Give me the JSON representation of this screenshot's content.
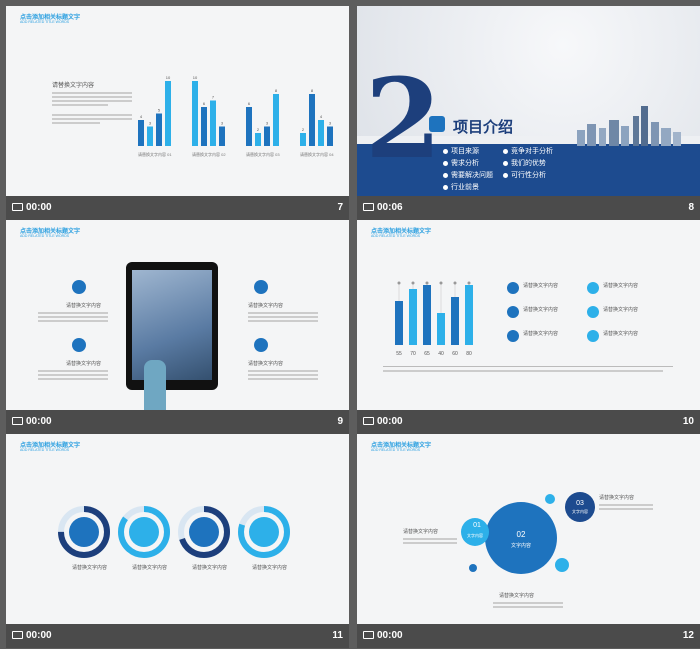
{
  "colors": {
    "blue": "#1e73be",
    "light": "#2db0e9",
    "dark": "#1d3f7c",
    "bg": "#5d5d5d"
  },
  "header": {
    "title": "点击添加相关标题文字",
    "sub": "ADD RELATED TITLE WORDS"
  },
  "slides": [
    {
      "num": "7",
      "time": "00:00",
      "body_title": "请替换文字内容",
      "group_labels": [
        "请替换文字内容 01",
        "请替换文字内容 02",
        "请替换文字内容 03",
        "请替换文字内容 04"
      ],
      "groups": [
        {
          "values": [
            4,
            3,
            5,
            10
          ]
        },
        {
          "values": [
            10,
            6,
            7,
            3
          ]
        },
        {
          "values": [
            6,
            2,
            3,
            8
          ]
        },
        {
          "values": [
            2,
            8,
            4,
            3
          ]
        }
      ]
    },
    {
      "num": "8",
      "time": "00:06",
      "big_number": "2",
      "title": "项目介绍",
      "items": [
        "项目来源",
        "需求分析",
        "需要解决问题",
        "行业前景",
        "竞争对手分析",
        "我们的优势",
        "可行性分析"
      ]
    },
    {
      "num": "9",
      "time": "00:00",
      "labels": [
        "请替换文字内容",
        "请替换文字内容",
        "请替换文字内容",
        "请替换文字内容"
      ]
    },
    {
      "num": "10",
      "time": "00:00",
      "chart_data": {
        "type": "bar",
        "categories": [
          "55",
          "70",
          "65",
          "40",
          "60",
          "80"
        ],
        "series": [
          {
            "values": [
              55,
              70,
              75,
              40,
              60,
              75
            ]
          }
        ]
      },
      "labels": [
        "请替换文字内容",
        "请替换文字内容",
        "请替换文字内容",
        "请替换文字内容",
        "请替换文字内容",
        "请替换文字内容"
      ]
    },
    {
      "num": "11",
      "time": "00:00",
      "labels": [
        "请替换文字内容",
        "请替换文字内容",
        "请替换文字内容",
        "请替换文字内容"
      ],
      "progress": [
        0.75,
        0.85,
        0.7,
        0.8
      ]
    },
    {
      "num": "12",
      "time": "00:00",
      "circles": [
        {
          "num": "01",
          "label": "文字内容"
        },
        {
          "num": "02",
          "label": "文字内容"
        },
        {
          "num": "03",
          "label": "文字内容"
        }
      ],
      "labels": [
        "请替换文字内容",
        "请替换文字内容",
        "请替换文字内容"
      ]
    }
  ]
}
